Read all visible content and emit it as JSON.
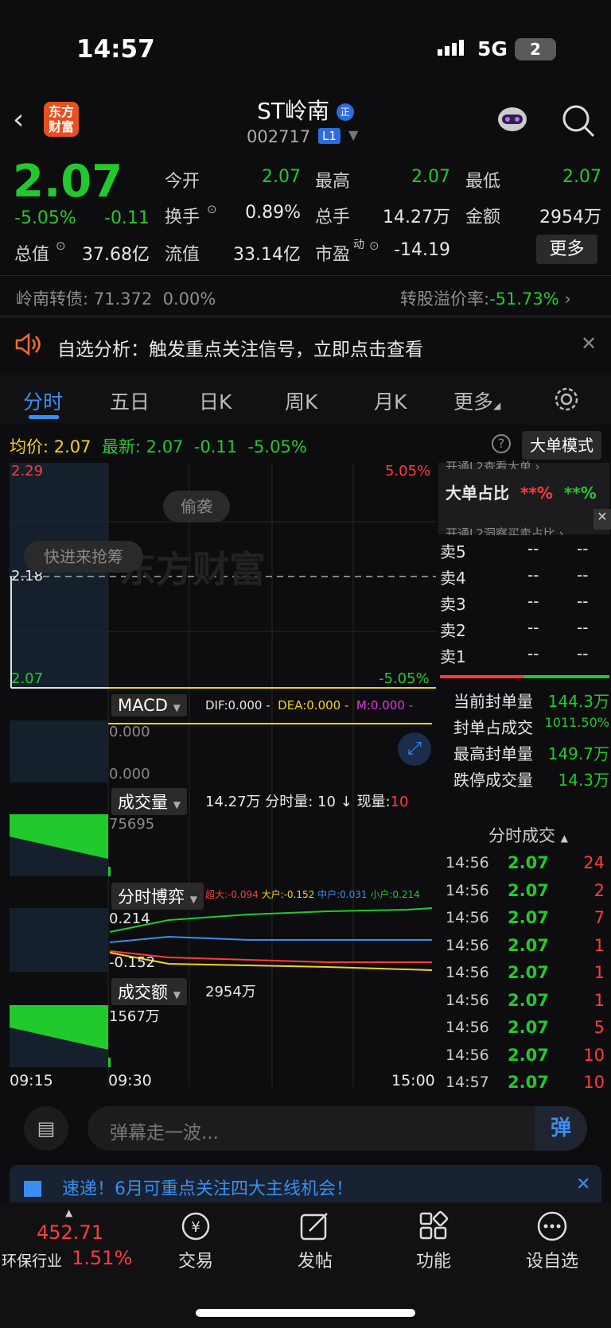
{
  "status": {
    "time": "14:57",
    "network": "5G",
    "battery": "2"
  },
  "header": {
    "back": "‹",
    "logo_line1": "东方",
    "logo_line2": "财富",
    "name": "ST岭南",
    "code": "002717",
    "level": "L1"
  },
  "quote": {
    "price": "2.07",
    "pct": "-5.05%",
    "chg": "-0.11",
    "open_lbl": "今开",
    "open": "2.07",
    "high_lbl": "最高",
    "high": "2.07",
    "low_lbl": "最低",
    "low": "2.07",
    "turn_lbl": "换手",
    "turn": "0.89%",
    "vol_lbl": "总手",
    "vol": "14.27万",
    "amt_lbl": "金额",
    "amt": "2954万",
    "mcap_lbl": "总值",
    "mcap": "37.68亿",
    "float_lbl": "流值",
    "float": "33.14亿",
    "pe_lbl": "市盈",
    "pe_sup": "动",
    "pe": "-14.19",
    "more": "更多"
  },
  "bond": {
    "label": "岭南转债:",
    "price": "71.372",
    "pct": "0.00%",
    "premium_lbl": "转股溢价率:",
    "premium": "-51.73%"
  },
  "alert": {
    "text": "自选分析：触发重点关注信号，立即点击查看"
  },
  "tabs": [
    "分时",
    "五日",
    "日K",
    "周K",
    "月K",
    "更多"
  ],
  "info": {
    "avg_lbl": "均价:",
    "avg": "2.07",
    "last_lbl": "最新:",
    "last": "2.07",
    "chg": "-0.11",
    "pct": "-5.05%",
    "mode": "大单模式"
  },
  "chart": {
    "top": "2.29",
    "mid": "2.18",
    "bot": "2.07",
    "top_pct": "5.05%",
    "bot_pct": "-5.05%",
    "watermark": "东方财富",
    "tag1": "偷袭",
    "tag2": "快进来抢筹",
    "time_start": "09:15",
    "time_mid": "09:30",
    "time_end": "15:00"
  },
  "macd": {
    "label": "MACD",
    "dif": "DIF:0.000 -",
    "dea": "DEA:0.000 -",
    "m": "M:0.000 -",
    "v1": "0.000",
    "v2": "0.000"
  },
  "volume": {
    "label": "成交量",
    "total": "14.27万",
    "fen": "分时量: 10 ↓",
    "cur_lbl": "现量:",
    "cur": "10",
    "max": "75695"
  },
  "game": {
    "label": "分时博弈",
    "super": "超大:-0.094",
    "big": "大户:-0.152",
    "mid": "中户:0.031",
    "small": "小户:0.214",
    "v_top": "0.214",
    "v_bot": "-0.152"
  },
  "amount": {
    "label": "成交额",
    "total": "2954万",
    "max": "1567万"
  },
  "right": {
    "promo": "开通L2查看大单 ›",
    "big_lbl": "大单占比",
    "big_r": "**%",
    "big_g": "**%",
    "promo2": "开通L2洞察买卖占比 ›",
    "sells": [
      {
        "n": "卖5",
        "p": "--",
        "v": "--"
      },
      {
        "n": "卖4",
        "p": "--",
        "v": "--"
      },
      {
        "n": "卖3",
        "p": "--",
        "v": "--"
      },
      {
        "n": "卖2",
        "p": "--",
        "v": "--"
      },
      {
        "n": "卖1",
        "p": "--",
        "v": "--"
      }
    ],
    "stats": [
      {
        "l": "当前封单量",
        "v": "144.3万"
      },
      {
        "l": "封单占成交",
        "v": "1011.50%"
      },
      {
        "l": "最高封单量",
        "v": "149.7万"
      },
      {
        "l": "跌停成交量",
        "v": "14.3万"
      }
    ],
    "ticks_title": "分时成交",
    "ticks": [
      {
        "t": "14:56",
        "p": "2.07",
        "v": "24"
      },
      {
        "t": "14:56",
        "p": "2.07",
        "v": "2"
      },
      {
        "t": "14:56",
        "p": "2.07",
        "v": "7"
      },
      {
        "t": "14:56",
        "p": "2.07",
        "v": "1"
      },
      {
        "t": "14:56",
        "p": "2.07",
        "v": "1"
      },
      {
        "t": "14:56",
        "p": "2.07",
        "v": "1"
      },
      {
        "t": "14:56",
        "p": "2.07",
        "v": "5"
      },
      {
        "t": "14:56",
        "p": "2.07",
        "v": "10"
      },
      {
        "t": "14:57",
        "p": "2.07",
        "v": "10"
      }
    ]
  },
  "danmu": {
    "placeholder": "弹幕走一波...",
    "btn": "弹"
  },
  "news": {
    "text": "速递！6月可重点关注四大主线机会！"
  },
  "bottom": {
    "index_val": "452.71",
    "index_name": "环保行业",
    "index_pct": "1.51%",
    "items": [
      "交易",
      "发帖",
      "功能",
      "设自选"
    ]
  }
}
